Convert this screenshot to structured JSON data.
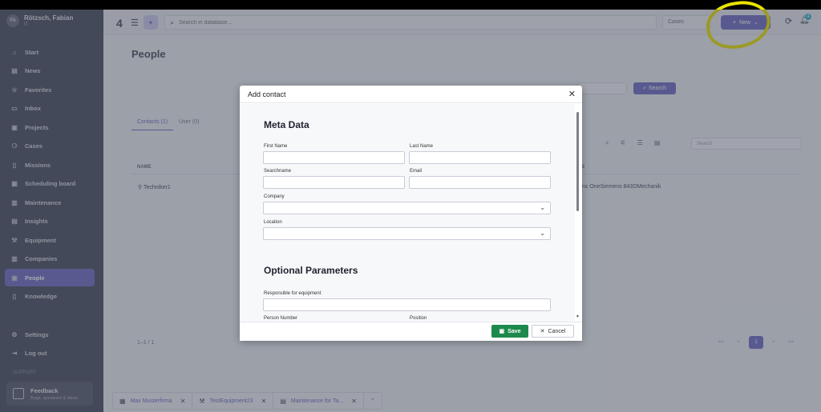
{
  "user": {
    "initials": "FA",
    "name": "Rötzsch, Fabian",
    "sub": "IT"
  },
  "nav": [
    {
      "label": "Start",
      "icon": "⌂"
    },
    {
      "label": "News",
      "icon": "▤"
    },
    {
      "label": "Favorites",
      "icon": "☆"
    },
    {
      "label": "Inbox",
      "icon": "▭"
    },
    {
      "label": "Projects",
      "icon": "▣"
    },
    {
      "label": "Cases",
      "icon": "⚆"
    },
    {
      "label": "Missions",
      "icon": "▯"
    },
    {
      "label": "Scheduling board",
      "icon": "▦"
    },
    {
      "label": "Maintenance",
      "icon": "▥"
    },
    {
      "label": "Insights",
      "icon": "▤"
    },
    {
      "label": "Equipment",
      "icon": "⚒"
    },
    {
      "label": "Companies",
      "icon": "▥"
    },
    {
      "label": "People",
      "icon": "▣"
    },
    {
      "label": "Knowledge",
      "icon": "▯"
    }
  ],
  "nav_bottom": [
    {
      "label": "Settings",
      "icon": "⚙"
    },
    {
      "label": "Log out",
      "icon": "⇥"
    }
  ],
  "support": {
    "label": "SUPPORT",
    "feedback_title": "Feedback",
    "feedback_sub": "Bugs, questions & ideas"
  },
  "header": {
    "logo": "4",
    "search_placeholder": "Search in database...",
    "scope": "Cases",
    "new_label": "New",
    "notification_count": "4"
  },
  "page": {
    "title": "People",
    "search_label": "Search",
    "tabs": [
      "Contacts (1)",
      "User (0)"
    ],
    "table_search_placeholder": "Search",
    "col_name": "NAME",
    "col_right": "S",
    "row_name": "Techniker1",
    "row_right": "ens OneSiemens 843DMechanik",
    "pager_count": "1–1 / 1",
    "pager": [
      "<<",
      "<",
      "1",
      ">",
      ">>"
    ]
  },
  "bottom_tabs": [
    {
      "label": "Max Musterfirma",
      "icon": "▦"
    },
    {
      "label": "TestEquipment23",
      "icon": "⚒"
    },
    {
      "label": "Maintenance for Ta...",
      "icon": "▤"
    }
  ],
  "modal": {
    "title": "Add contact",
    "meta_heading": "Meta Data",
    "first_name_label": "First Name",
    "last_name_label": "Last Name",
    "searchname_label": "Searchname",
    "email_label": "Email",
    "company_label": "Company",
    "location_label": "Location",
    "optional_heading": "Optional Parameters",
    "responsible_label": "Responsible for equipment",
    "person_number_label": "Person Number",
    "position_label": "Position",
    "save_label": "Save",
    "cancel_label": "Cancel"
  }
}
